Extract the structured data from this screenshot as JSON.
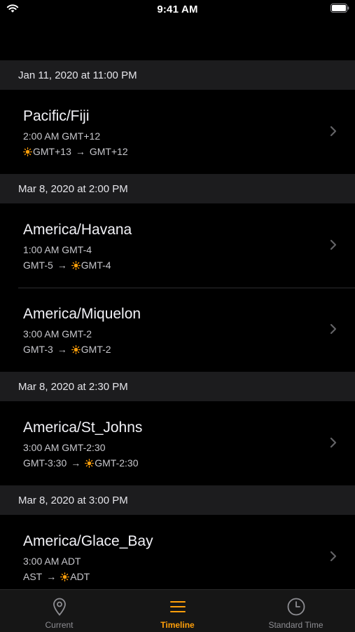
{
  "status_bar": {
    "time": "9:41 AM"
  },
  "sections": [
    {
      "header": "Jan 11, 2020 at 11:00 PM",
      "rows": [
        {
          "title": "Pacific/Fiji",
          "subtitle": "2:00 AM GMT+12",
          "from": "GMT+13",
          "from_dst": true,
          "to": "GMT+12",
          "to_dst": false
        }
      ]
    },
    {
      "header": "Mar 8, 2020 at 2:00 PM",
      "rows": [
        {
          "title": "America/Havana",
          "subtitle": "1:00 AM GMT-4",
          "from": "GMT-5",
          "from_dst": false,
          "to": "GMT-4",
          "to_dst": true
        },
        {
          "title": "America/Miquelon",
          "subtitle": "3:00 AM GMT-2",
          "from": "GMT-3",
          "from_dst": false,
          "to": "GMT-2",
          "to_dst": true
        }
      ]
    },
    {
      "header": "Mar 8, 2020 at 2:30 PM",
      "rows": [
        {
          "title": "America/St_Johns",
          "subtitle": "3:00 AM GMT-2:30",
          "from": "GMT-3:30",
          "from_dst": false,
          "to": "GMT-2:30",
          "to_dst": true
        }
      ]
    },
    {
      "header": "Mar 8, 2020 at 3:00 PM",
      "rows": [
        {
          "title": "America/Glace_Bay",
          "subtitle": "3:00 AM ADT",
          "from": "AST",
          "from_dst": false,
          "to": "ADT",
          "to_dst": true
        }
      ]
    }
  ],
  "tab_bar": {
    "tabs": [
      {
        "label": "Current",
        "icon": "location-pin-icon"
      },
      {
        "label": "Timeline",
        "icon": "list-icon"
      },
      {
        "label": "Standard Time",
        "icon": "clock-icon"
      }
    ],
    "active": "Timeline"
  },
  "colors": {
    "accent": "#ff9f0a",
    "section_bg": "#1c1c1e",
    "tab_bar_bg": "#161616",
    "sun": "#ff9f0a"
  }
}
